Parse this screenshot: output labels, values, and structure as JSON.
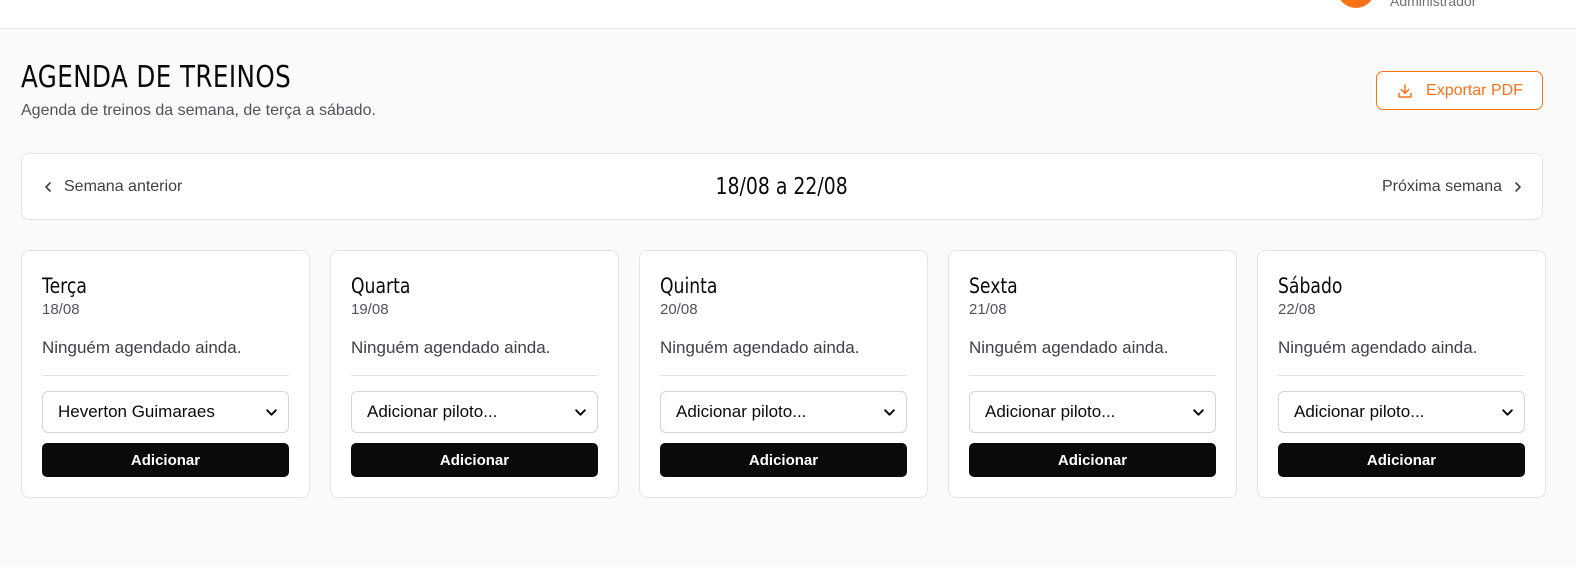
{
  "header": {
    "user_role": "Administrador",
    "accent_color": "#f97316"
  },
  "page": {
    "title": "AGENDA DE TREINOS",
    "subtitle": "Agenda de treinos da semana, de terça a sábado.",
    "export_label": "Exportar PDF",
    "export_icon": "download-icon"
  },
  "week_nav": {
    "prev_label": "Semana anterior",
    "next_label": "Próxima semana",
    "range": "18/08 a 22/08"
  },
  "days": [
    {
      "name": "Terça",
      "date": "18/08",
      "empty_text": "Ninguém agendado ainda.",
      "select_value": "Heverton Guimaraes",
      "button_label": "Adicionar"
    },
    {
      "name": "Quarta",
      "date": "19/08",
      "empty_text": "Ninguém agendado ainda.",
      "select_value": "Adicionar piloto...",
      "button_label": "Adicionar"
    },
    {
      "name": "Quinta",
      "date": "20/08",
      "empty_text": "Ninguém agendado ainda.",
      "select_value": "Adicionar piloto...",
      "button_label": "Adicionar"
    },
    {
      "name": "Sexta",
      "date": "21/08",
      "empty_text": "Ninguém agendado ainda.",
      "select_value": "Adicionar piloto...",
      "button_label": "Adicionar"
    },
    {
      "name": "Sábado",
      "date": "22/08",
      "empty_text": "Ninguém agendado ainda.",
      "select_value": "Adicionar piloto...",
      "button_label": "Adicionar"
    }
  ]
}
